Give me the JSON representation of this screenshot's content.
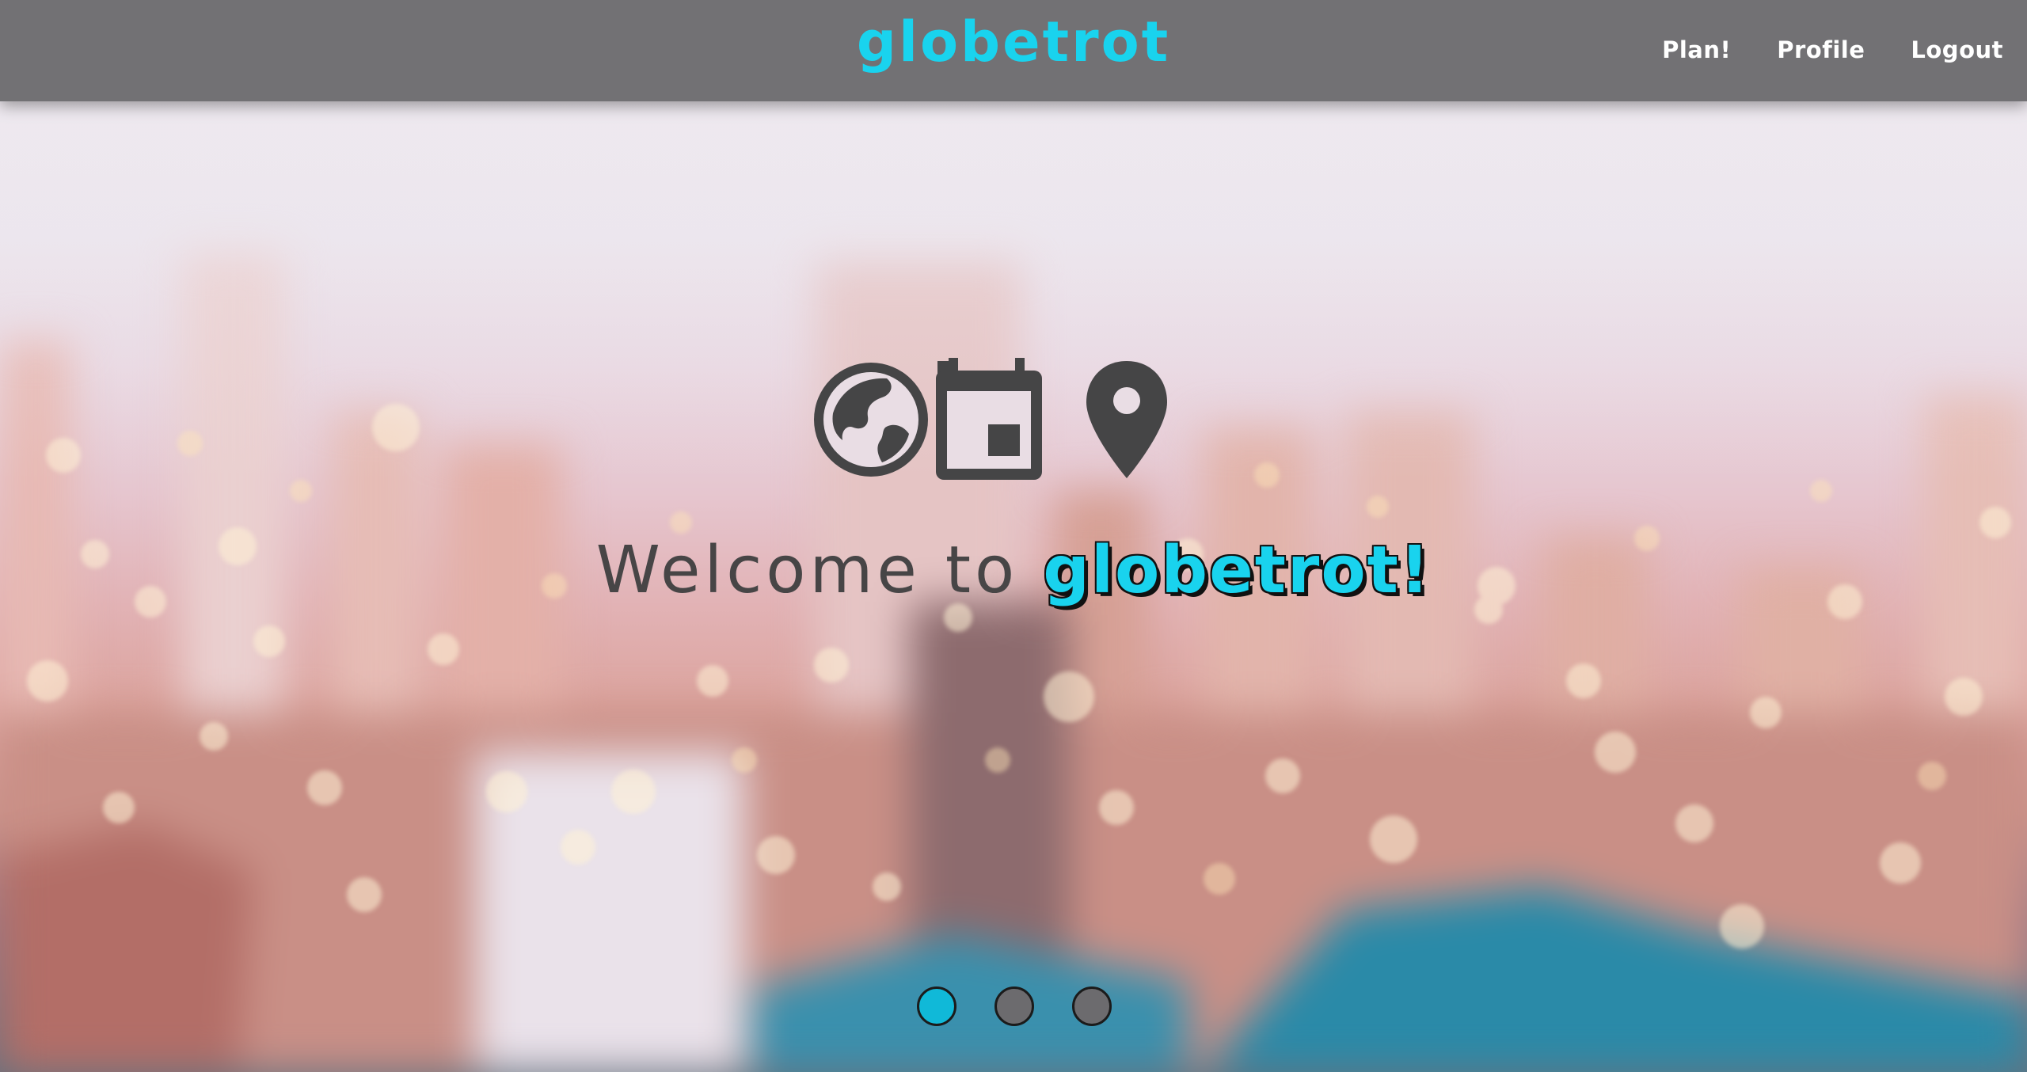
{
  "brand": {
    "name": "globetrot",
    "color": "#19d3ee"
  },
  "nav": {
    "links": [
      {
        "label": "Plan!"
      },
      {
        "label": "Profile"
      },
      {
        "label": "Logout"
      }
    ],
    "background": "#727174"
  },
  "hero": {
    "icons": [
      "globe-icon",
      "calendar-icon",
      "map-pin-icon"
    ],
    "welcome_lead": "Welcome to",
    "welcome_brand": "globetrot!",
    "background": "blurred city skyline with bokeh lights"
  },
  "carousel": {
    "slide_count": 3,
    "active_index": 0,
    "active_color": "#10b9d8",
    "inactive_color": "#6c6b6e"
  }
}
